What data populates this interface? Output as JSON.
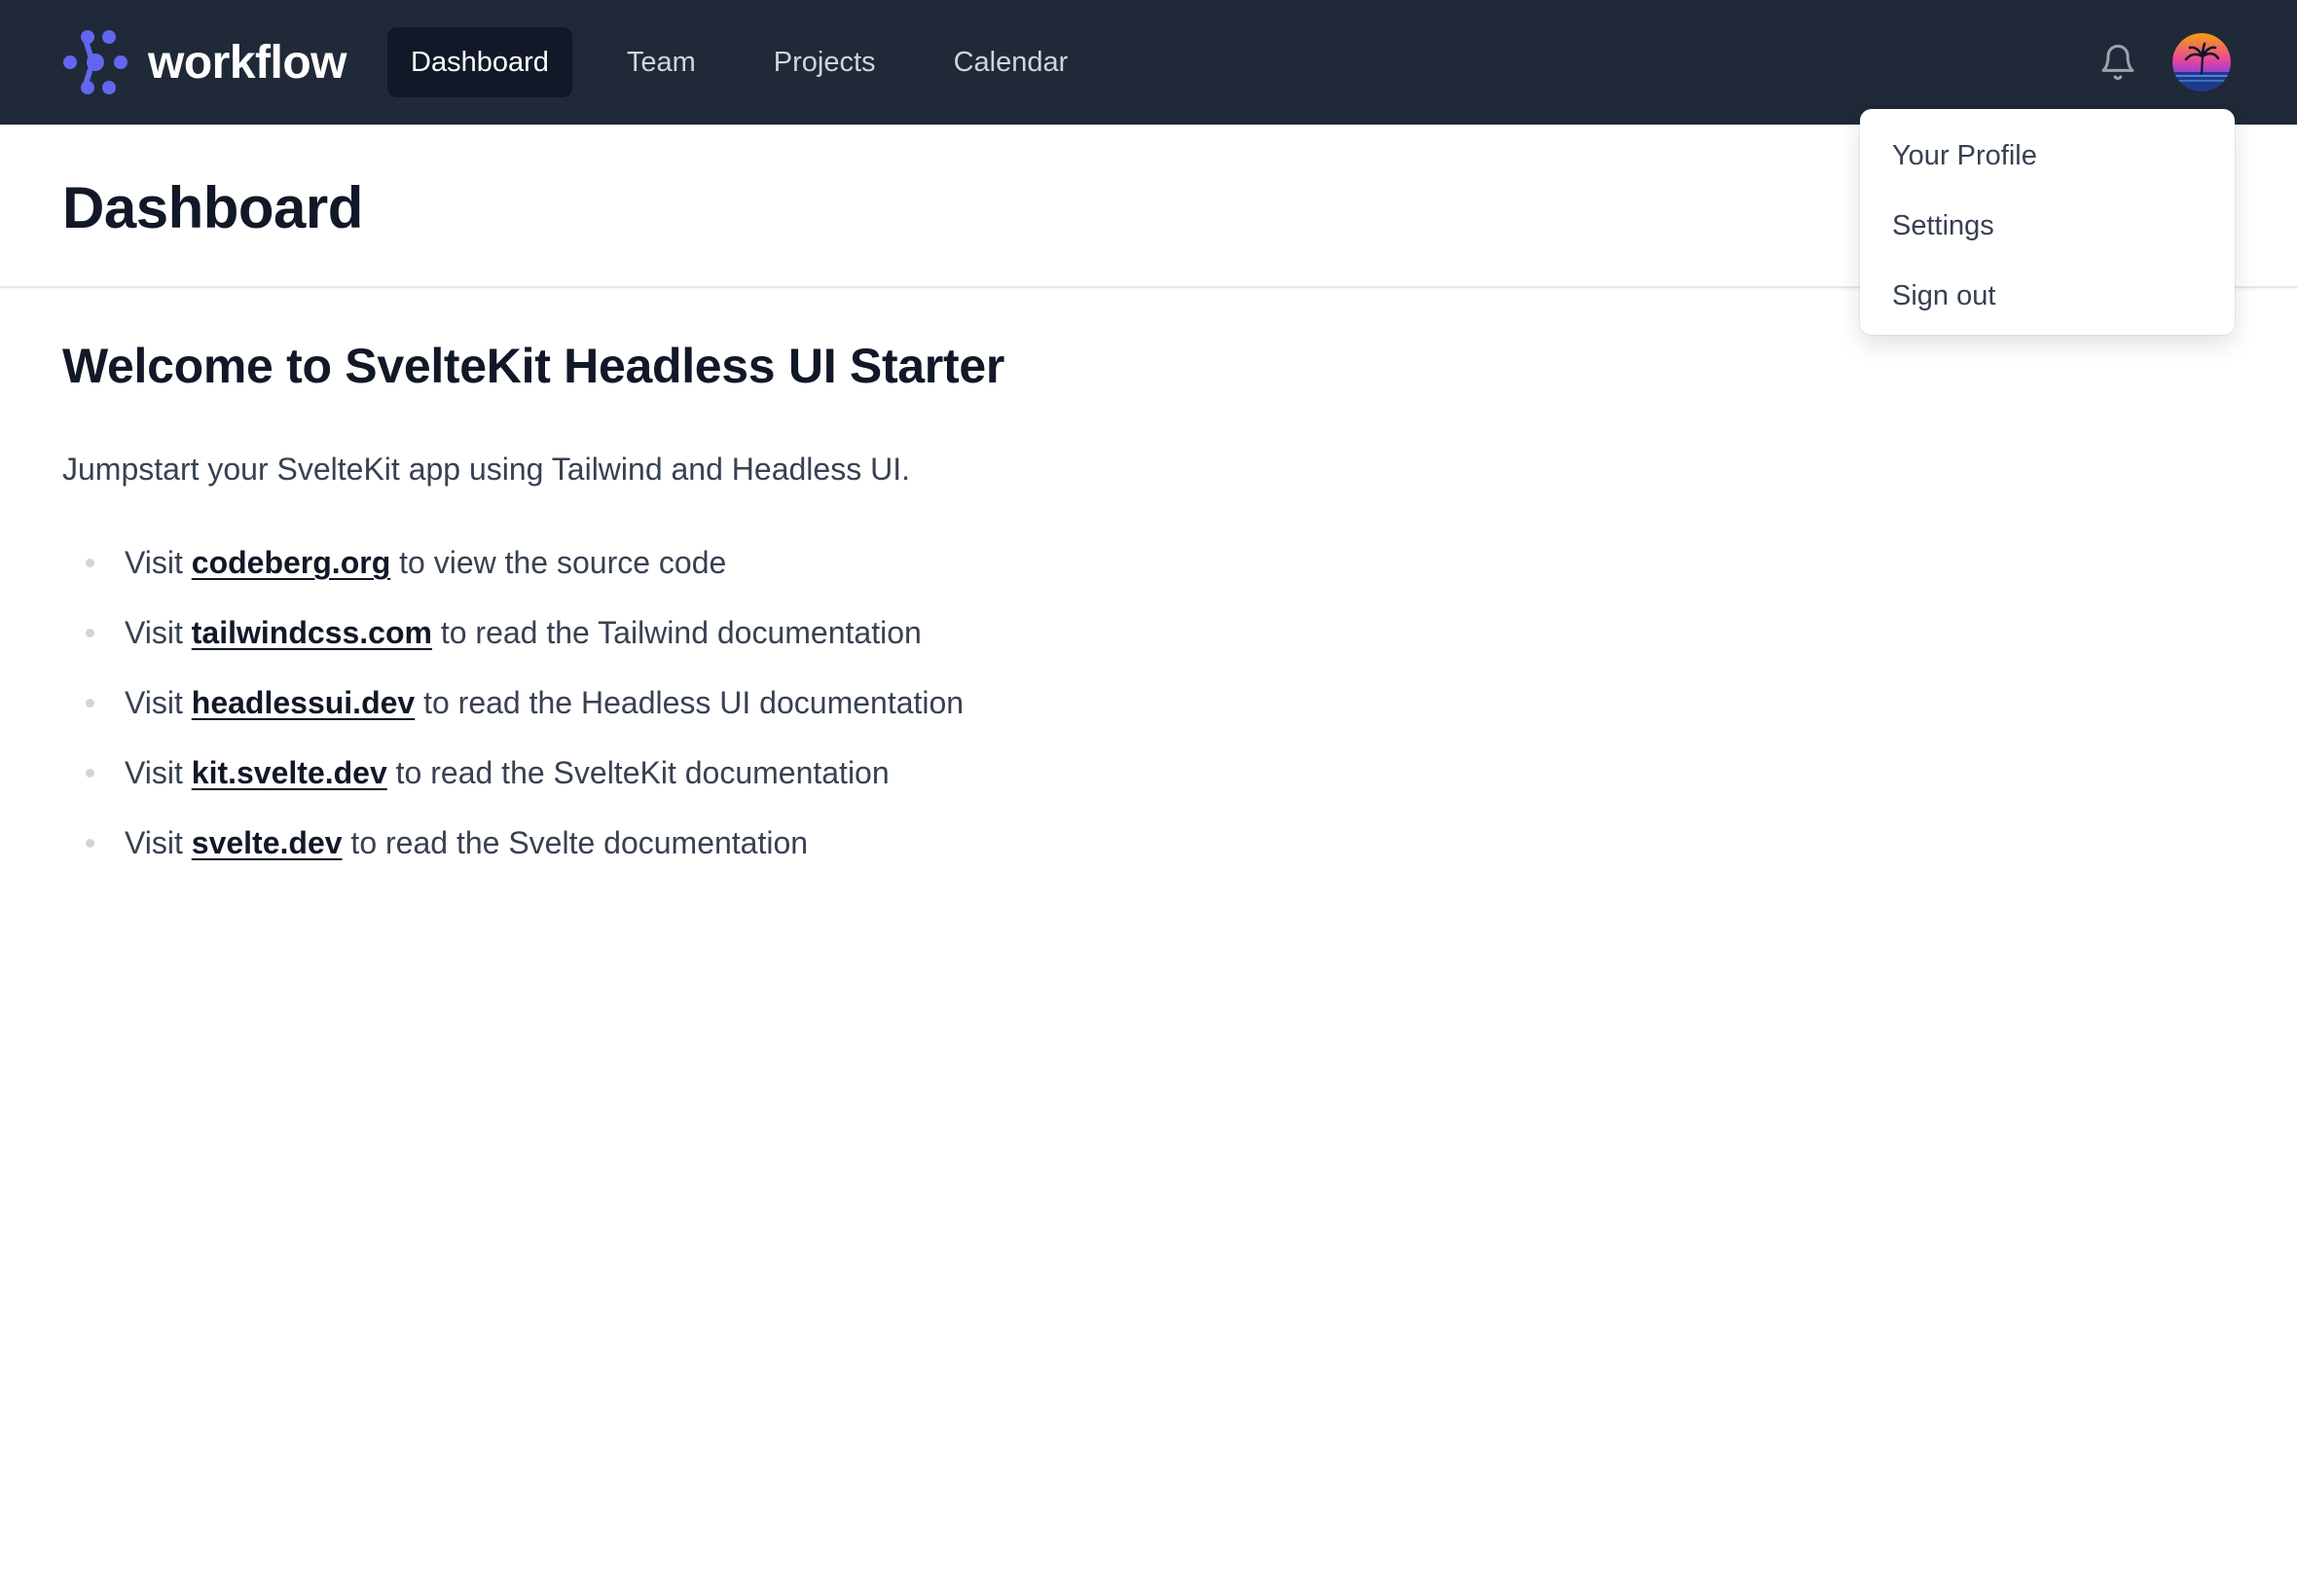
{
  "brand": {
    "name": "workflow",
    "logo_icon": "workflow-logo-icon",
    "accent_color": "#6366f1"
  },
  "nav": {
    "items": [
      {
        "label": "Dashboard",
        "active": true
      },
      {
        "label": "Team",
        "active": false
      },
      {
        "label": "Projects",
        "active": false
      },
      {
        "label": "Calendar",
        "active": false
      }
    ],
    "notification_icon": "bell-icon",
    "avatar_icon": "user-avatar"
  },
  "user_menu": {
    "items": [
      {
        "label": "Your Profile"
      },
      {
        "label": "Settings"
      },
      {
        "label": "Sign out"
      }
    ]
  },
  "header": {
    "title": "Dashboard"
  },
  "main": {
    "heading": "Welcome to SvelteKit Headless UI Starter",
    "intro": "Jumpstart your SvelteKit app using Tailwind and Headless UI.",
    "links": [
      {
        "prefix": "Visit ",
        "link": "codeberg.org",
        "suffix": " to view the source code"
      },
      {
        "prefix": "Visit ",
        "link": "tailwindcss.com",
        "suffix": " to read the Tailwind documentation"
      },
      {
        "prefix": "Visit ",
        "link": "headlessui.dev",
        "suffix": " to read the Headless UI documentation"
      },
      {
        "prefix": "Visit ",
        "link": "kit.svelte.dev",
        "suffix": " to read the SvelteKit documentation"
      },
      {
        "prefix": "Visit ",
        "link": "svelte.dev",
        "suffix": " to read the Svelte documentation"
      }
    ]
  },
  "colors": {
    "navbar_bg": "#1f2937",
    "nav_active_bg": "#111827",
    "nav_text": "#d1d5db",
    "body_text": "#374151",
    "heading_text": "#111827"
  }
}
